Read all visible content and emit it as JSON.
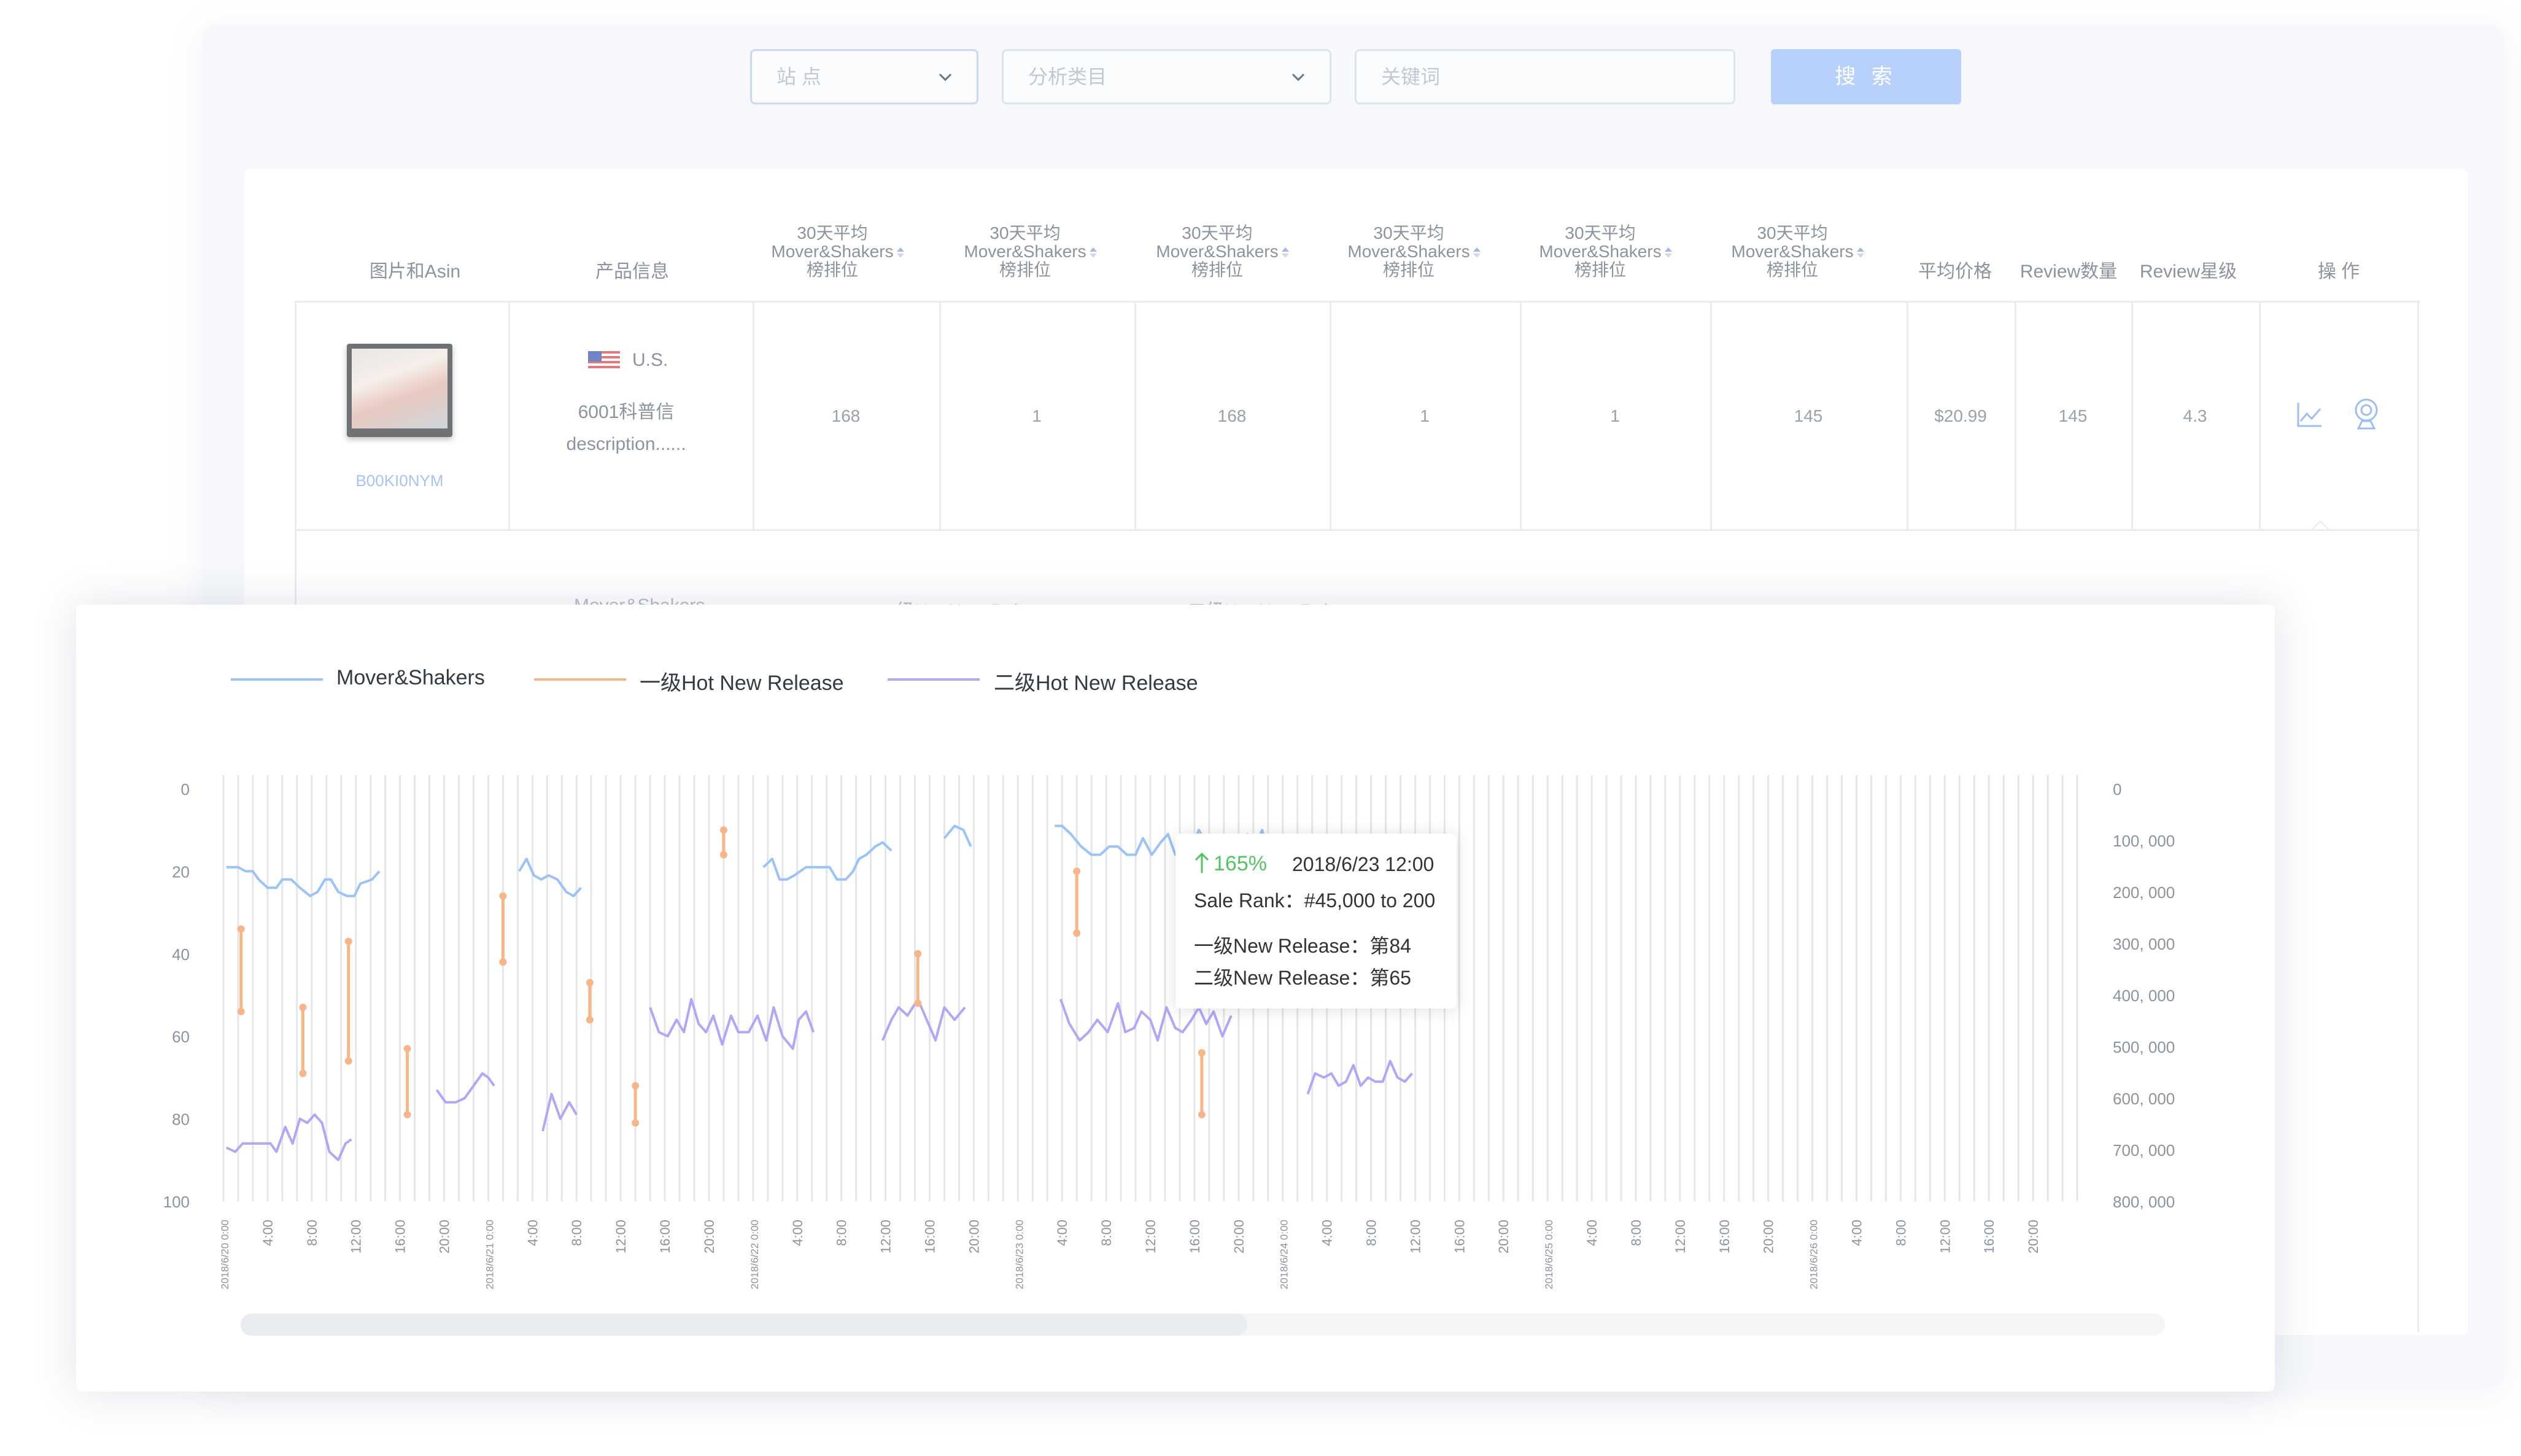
{
  "filters": {
    "site_placeholder": "站 点",
    "category_placeholder": "分析类目",
    "keyword_placeholder": "关键词",
    "search_label": "搜 索"
  },
  "table": {
    "headers": {
      "image_asin": "图片和Asin",
      "product_info": "产品信息",
      "rank_line1": "30天平均",
      "rank_line2": "Mover&Shakers",
      "rank_line3": "榜排位",
      "avg_price": "平均价格",
      "review_count": "Review数量",
      "review_stars": "Review星级",
      "actions": "操 作"
    },
    "row": {
      "asin": "B00KI0NYM",
      "country": "U.S.",
      "name_line1": "6001科普信",
      "name_line2": "description......",
      "ranks": [
        "168",
        "1",
        "168",
        "1",
        "1",
        "145"
      ],
      "avg_price": "$20.99",
      "review_count": "145",
      "review_stars": "4.3"
    }
  },
  "chart_data": {
    "type": "line",
    "series": [
      {
        "name": "Mover&Shakers",
        "color": "#9cc3f5",
        "axis": "left"
      },
      {
        "name": "一级Hot New Release",
        "color": "#f7b58a",
        "axis": "left"
      },
      {
        "name": "二级Hot New Release",
        "color": "#b3a7f5",
        "axis": "left"
      }
    ],
    "left_axis": {
      "ticks": [
        "0",
        "20",
        "40",
        "60",
        "80",
        "100"
      ],
      "range": [
        0,
        100
      ],
      "inverted": true
    },
    "right_axis": {
      "ticks": [
        "0",
        "100, 000",
        "200, 000",
        "300, 000",
        "400, 000",
        "500, 000",
        "600, 000",
        "700, 000",
        "800, 000"
      ],
      "range": [
        0,
        800000
      ],
      "inverted": true
    },
    "x_ticks": [
      "2018/6/20 0:00",
      "4:00",
      "8:00",
      "12:00",
      "16:00",
      "20:00",
      "2018/6/21 0:00",
      "4:00",
      "8:00",
      "12:00",
      "16:00",
      "20:00",
      "2018/6/22 0:00",
      "4:00",
      "8:00",
      "12:00",
      "16:00",
      "20:00",
      "2018/6/23 0:00",
      "4:00",
      "8:00",
      "12:00",
      "16:00",
      "20:00",
      "2018/6/24 0:00",
      "4:00",
      "8:00",
      "12:00",
      "16:00",
      "20:00",
      "2018/6/25 0:00",
      "4:00",
      "8:00",
      "12:00",
      "16:00",
      "20:00",
      "2018/6/26 0:00",
      "4:00",
      "8:00",
      "12:00",
      "16:00",
      "20:00"
    ],
    "mover_segments": [
      [
        [
          0.2,
          19
        ],
        [
          1.0,
          19
        ],
        [
          1.5,
          20
        ],
        [
          2.0,
          20
        ],
        [
          2.4,
          22
        ],
        [
          3.0,
          24
        ],
        [
          3.6,
          24
        ],
        [
          4.0,
          22
        ],
        [
          4.6,
          22
        ],
        [
          5.2,
          24
        ],
        [
          5.9,
          26
        ],
        [
          6.4,
          25
        ],
        [
          6.9,
          22
        ],
        [
          7.3,
          22
        ],
        [
          7.8,
          25
        ],
        [
          8.4,
          26
        ],
        [
          8.9,
          26
        ],
        [
          9.3,
          23
        ],
        [
          10.1,
          22
        ],
        [
          10.6,
          20
        ]
      ],
      [
        [
          20.1,
          20
        ],
        [
          20.6,
          17
        ],
        [
          21.1,
          21
        ],
        [
          21.6,
          22
        ],
        [
          22.1,
          21
        ],
        [
          22.7,
          22
        ],
        [
          23.3,
          25
        ],
        [
          23.8,
          26
        ],
        [
          24.3,
          24
        ]
      ],
      [
        [
          36.7,
          19
        ],
        [
          37.3,
          17
        ],
        [
          37.8,
          22
        ],
        [
          38.3,
          22
        ],
        [
          38.8,
          21
        ],
        [
          39.6,
          19
        ],
        [
          40.6,
          19
        ],
        [
          41.2,
          19
        ],
        [
          41.7,
          22
        ],
        [
          42.3,
          22
        ],
        [
          42.8,
          20
        ],
        [
          43.2,
          17
        ],
        [
          43.7,
          16
        ],
        [
          44.3,
          14
        ],
        [
          44.8,
          13
        ],
        [
          45.4,
          15
        ]
      ],
      [
        [
          49.0,
          12
        ],
        [
          49.7,
          9
        ],
        [
          50.3,
          10
        ],
        [
          50.8,
          14
        ]
      ],
      [
        [
          56.5,
          9
        ],
        [
          57.0,
          9
        ],
        [
          57.6,
          11
        ],
        [
          58.3,
          14
        ],
        [
          59.0,
          16
        ],
        [
          59.6,
          16
        ],
        [
          60.2,
          14
        ],
        [
          60.8,
          14
        ],
        [
          61.4,
          16
        ],
        [
          62.0,
          16
        ],
        [
          62.5,
          12
        ],
        [
          63.1,
          16
        ],
        [
          63.7,
          13
        ],
        [
          64.2,
          11
        ],
        [
          64.7,
          16
        ],
        [
          65.2,
          14
        ],
        [
          65.8,
          14
        ],
        [
          66.3,
          10
        ],
        [
          66.9,
          14
        ],
        [
          67.5,
          16
        ],
        [
          68.0,
          22
        ],
        [
          68.8,
          17
        ],
        [
          69.6,
          11
        ],
        [
          70.1,
          14
        ],
        [
          70.6,
          10
        ],
        [
          71.1,
          16
        ],
        [
          71.6,
          20
        ],
        [
          72.1,
          15
        ],
        [
          72.7,
          19
        ]
      ]
    ],
    "hot1_bars": [
      [
        1.2,
        34,
        54
      ],
      [
        5.4,
        53,
        69
      ],
      [
        8.5,
        37,
        66
      ],
      [
        12.5,
        63,
        79
      ],
      [
        19.0,
        26,
        42
      ],
      [
        24.9,
        47,
        56
      ],
      [
        28.0,
        72,
        81
      ],
      [
        34.0,
        10,
        16
      ],
      [
        47.2,
        40,
        52
      ],
      [
        58.0,
        20,
        35
      ],
      [
        66.5,
        64,
        79
      ],
      [
        70.0,
        28,
        49
      ]
    ],
    "hot2_segments": [
      [
        [
          0.2,
          87
        ],
        [
          0.8,
          88
        ],
        [
          1.3,
          86
        ],
        [
          1.9,
          86
        ],
        [
          2.6,
          86
        ],
        [
          3.2,
          86
        ],
        [
          3.6,
          88
        ],
        [
          4.2,
          82
        ],
        [
          4.7,
          86
        ],
        [
          5.2,
          80
        ],
        [
          5.7,
          81
        ],
        [
          6.2,
          79
        ],
        [
          6.7,
          81
        ],
        [
          7.2,
          88
        ],
        [
          7.8,
          90
        ],
        [
          8.3,
          86
        ],
        [
          8.7,
          85
        ]
      ],
      [
        [
          14.5,
          73
        ],
        [
          15.1,
          76
        ],
        [
          15.8,
          76
        ],
        [
          16.4,
          75
        ],
        [
          17.0,
          72
        ],
        [
          17.6,
          69
        ],
        [
          18.0,
          70
        ],
        [
          18.4,
          72
        ]
      ],
      [
        [
          21.7,
          83
        ],
        [
          22.3,
          74
        ],
        [
          22.9,
          80
        ],
        [
          23.5,
          76
        ],
        [
          24.0,
          79
        ]
      ],
      [
        [
          29.0,
          53
        ],
        [
          29.6,
          59
        ],
        [
          30.2,
          60
        ],
        [
          30.8,
          56
        ],
        [
          31.3,
          59
        ],
        [
          31.8,
          51
        ],
        [
          32.3,
          57
        ],
        [
          32.8,
          59
        ],
        [
          33.3,
          55
        ],
        [
          33.9,
          62
        ],
        [
          34.5,
          55
        ],
        [
          35.0,
          59
        ],
        [
          35.7,
          59
        ],
        [
          36.3,
          55
        ],
        [
          36.9,
          61
        ],
        [
          37.4,
          53
        ],
        [
          38.0,
          60
        ],
        [
          38.7,
          63
        ],
        [
          39.1,
          56
        ],
        [
          39.6,
          54
        ],
        [
          40.1,
          59
        ]
      ],
      [
        [
          44.8,
          61
        ],
        [
          45.4,
          56
        ],
        [
          45.9,
          53
        ],
        [
          46.5,
          55
        ],
        [
          47.2,
          51
        ],
        [
          47.8,
          56
        ],
        [
          48.4,
          61
        ],
        [
          49.0,
          53
        ],
        [
          49.7,
          56
        ],
        [
          50.4,
          53
        ]
      ],
      [
        [
          56.9,
          51
        ],
        [
          57.5,
          57
        ],
        [
          58.2,
          61
        ],
        [
          58.8,
          59
        ],
        [
          59.4,
          56
        ],
        [
          60.1,
          59
        ],
        [
          60.8,
          52
        ],
        [
          61.3,
          59
        ],
        [
          61.9,
          58
        ],
        [
          62.4,
          54
        ],
        [
          63.0,
          56
        ],
        [
          63.5,
          61
        ],
        [
          64.1,
          53
        ],
        [
          64.7,
          58
        ],
        [
          65.2,
          59
        ],
        [
          65.8,
          56
        ],
        [
          66.3,
          53
        ],
        [
          66.8,
          57
        ],
        [
          67.3,
          54
        ],
        [
          67.9,
          60
        ],
        [
          68.5,
          55
        ]
      ],
      [
        [
          73.7,
          74
        ],
        [
          74.2,
          69
        ],
        [
          74.8,
          70
        ],
        [
          75.3,
          69
        ],
        [
          75.8,
          72
        ],
        [
          76.3,
          71
        ],
        [
          76.8,
          67
        ],
        [
          77.3,
          72
        ],
        [
          77.8,
          70
        ],
        [
          78.3,
          71
        ],
        [
          78.8,
          71
        ],
        [
          79.3,
          66
        ],
        [
          79.8,
          70
        ],
        [
          80.3,
          71
        ],
        [
          80.8,
          69
        ]
      ]
    ]
  },
  "tooltip": {
    "pct": "165%",
    "time": "2018/6/23 12:00",
    "sale_rank": "Sale Rank：#45,000 to 200",
    "rel1": "一级New Release：第84",
    "rel2": "二级New Release：第65"
  },
  "bg_legend_ghost": {
    "item1": "Mover&Shakers",
    "item2": "一级Hot New Release",
    "item3": "二级Hot New Release"
  }
}
